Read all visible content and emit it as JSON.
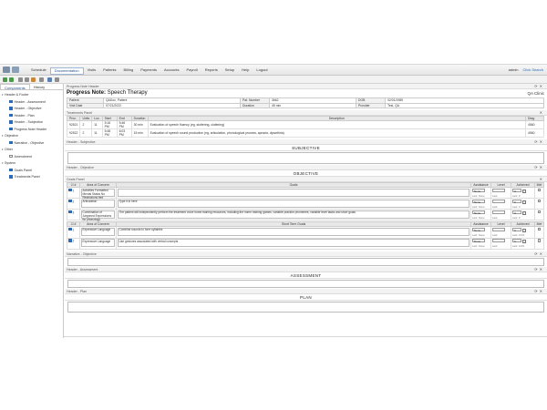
{
  "menu": {
    "items": [
      "Schedule",
      "Documentation",
      "Visits",
      "Patients",
      "Billing",
      "Payments",
      "Accounts",
      "Payroll",
      "Reports",
      "Setup",
      "Help",
      "Logout"
    ],
    "active": "Documentation",
    "user": "admin",
    "click_search": "Click Search"
  },
  "left": {
    "tabs": [
      "Components",
      "History"
    ],
    "active_tab": "Components",
    "tree": [
      {
        "label": "Header & Footer",
        "level": 0,
        "checked": null,
        "expander": true
      },
      {
        "label": "Header - Assessment",
        "level": 1,
        "checked": true
      },
      {
        "label": "Header - Objective",
        "level": 1,
        "checked": true
      },
      {
        "label": "Header - Plan",
        "level": 1,
        "checked": true
      },
      {
        "label": "Header - Subjective",
        "level": 1,
        "checked": true
      },
      {
        "label": "Progress Note Header",
        "level": 1,
        "checked": true
      },
      {
        "label": "Objective",
        "level": 0,
        "checked": null,
        "expander": true
      },
      {
        "label": "Narrative - Objective",
        "level": 1,
        "checked": true
      },
      {
        "label": "Other",
        "level": 0,
        "checked": null,
        "expander": true
      },
      {
        "label": "Amendment",
        "level": 1,
        "checked": false
      },
      {
        "label": "System",
        "level": 0,
        "checked": null,
        "expander": true
      },
      {
        "label": "Goals Panel",
        "level": 1,
        "checked": true
      },
      {
        "label": "Treatments Panel",
        "level": 1,
        "checked": true
      }
    ]
  },
  "note": {
    "header_label": "Progress Note Header",
    "title_prefix": "Progress Note:",
    "title": "Speech Therapy",
    "clinic": "QA Clinic",
    "patient_label": "Patient",
    "patient": "QADoc, Patient",
    "ptnum_label": "Pat. Number",
    "ptnum": "3662",
    "dob_label": "DOB",
    "dob": "02/01/1985",
    "visitdate_label": "Visit Date",
    "visitdate": "07/21/2022",
    "duration_label": "Duration",
    "duration": "45 min",
    "provider_label": "Provider",
    "provider": "Test, QA"
  },
  "treatments": {
    "header": "Treatments Panel",
    "columns": [
      "Proc.",
      "Units",
      "Loc.",
      "Start",
      "End",
      "Duration",
      "Description",
      "Diag."
    ],
    "rows": [
      [
        "92521",
        "2",
        "11",
        "5:16 PM",
        "5:46 PM",
        "30 min",
        "Evaluation of speech fluency (eg, stuttering, cluttering)",
        "4560"
      ],
      [
        "92522",
        "2",
        "11",
        "5:48 PM",
        "6:03 PM",
        "15 min",
        "Evaluation of speech sound production (eg, articulation, phonological process, apraxia, dysarthria)",
        "4560"
      ]
    ]
  },
  "subjective": {
    "header": "Header - Subjective",
    "title": "SUBJECTIVE"
  },
  "objective": {
    "header": "Header - Objective",
    "title": "OBJECTIVE"
  },
  "goals": {
    "header": "Goals Panel",
    "long_cols": [
      "Area of Concern",
      "Goals",
      "Assistance",
      "Level",
      "Achieved",
      "Met"
    ],
    "short_cols": [
      "Area of Concern",
      "Short Term Goals",
      "Assistance",
      "Level",
      "Achieved",
      "Met"
    ],
    "long_rows": [
      {
        "num": "1",
        "area": "Activities Formatted Mental Status",
        "area_sub": "No Restrictions tied",
        "goal": "",
        "assist": "None",
        "assist_sub": "Last: None",
        "level": "",
        "level_sub": "Last:",
        "achieved": "0",
        "achieved_sub": "Last: 0"
      },
      {
        "num": "2",
        "area": "Articulation",
        "area_sub": "",
        "goal": "Type it in here",
        "assist": "None",
        "assist_sub": "Last: None",
        "level": "",
        "level_sub": "Last:",
        "achieved": "0",
        "achieved_sub": "Last: 0"
      },
      {
        "num": "3",
        "area": "Combination of Jargoned Expressions for phonology",
        "area_sub": "",
        "goal": "The patient will independently perform the treatment voice home training resources, including the home training games, variable practice phonemes, variable level tasks and short goals.",
        "assist": "None",
        "assist_sub": "Last: None",
        "level": "",
        "level_sub": "Last:",
        "achieved": "0",
        "achieved_sub": "Last: 0"
      }
    ],
    "short_rows": [
      {
        "num": "1",
        "area": "Expressive Language",
        "goal": "Combine sounds to form syllables",
        "assist": "None",
        "assist_sub": "Last: None",
        "level": "",
        "level_sub": "Last:",
        "achieved": "0",
        "achieved_sub": "Last: 0.0%"
      },
      {
        "num": "2",
        "area": "Expressive Language",
        "goal": "Use gestures associated with verbal concepts",
        "assist": "None",
        "assist_sub": "Last: None",
        "level": "",
        "level_sub": "Last:",
        "achieved": "0",
        "achieved_sub": "Last: 0.0%"
      }
    ]
  },
  "narrative": {
    "header": "Narrative - Objective"
  },
  "assessment": {
    "header": "Header - Assessment",
    "title": "ASSESSMENT"
  },
  "plan": {
    "header": "Header - Plan",
    "title": "PLAN"
  }
}
